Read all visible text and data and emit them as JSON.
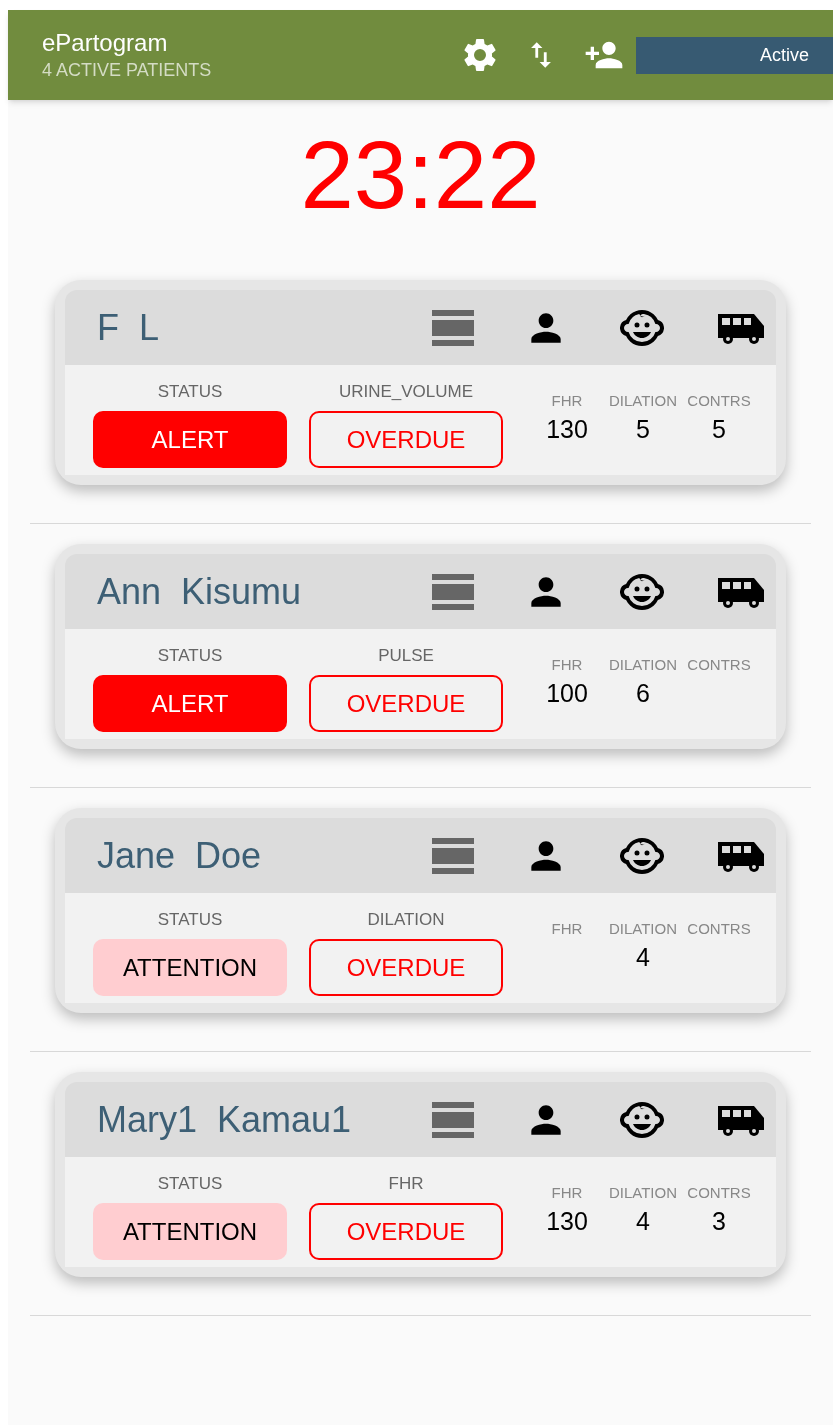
{
  "app_bar": {
    "title": "ePartogram",
    "subtitle": "4 ACTIVE PATIENTS",
    "filter": "Active"
  },
  "timer": "23:22",
  "patients": [
    {
      "name": "F  L",
      "status_label": "STATUS",
      "status": {
        "text": "ALERT",
        "kind": "alert"
      },
      "due_label": "URINE_VOLUME",
      "due": "OVERDUE",
      "metrics": [
        {
          "label": "FHR",
          "value": "130"
        },
        {
          "label": "DILATION",
          "value": "5"
        },
        {
          "label": "CONTRS",
          "value": "5"
        }
      ]
    },
    {
      "name": "Ann  Kisumu",
      "status_label": "STATUS",
      "status": {
        "text": "ALERT",
        "kind": "alert"
      },
      "due_label": "PULSE",
      "due": "OVERDUE",
      "metrics": [
        {
          "label": "FHR",
          "value": "100"
        },
        {
          "label": "DILATION",
          "value": "6"
        },
        {
          "label": "CONTRS"
        }
      ]
    },
    {
      "name": "Jane  Doe",
      "status_label": "STATUS",
      "status": {
        "text": "ATTENTION",
        "kind": "attention"
      },
      "due_label": "DILATION",
      "due": "OVERDUE",
      "metrics": [
        {
          "label": "FHR"
        },
        {
          "label": "DILATION",
          "value": "4"
        },
        {
          "label": "CONTRS"
        }
      ]
    },
    {
      "name": "Mary1  Kamau1",
      "status_label": "STATUS",
      "status": {
        "text": "ATTENTION",
        "kind": "attention"
      },
      "due_label": "FHR",
      "due": "OVERDUE",
      "metrics": [
        {
          "label": "FHR",
          "value": "130"
        },
        {
          "label": "DILATION",
          "value": "4"
        },
        {
          "label": "CONTRS",
          "value": "3"
        }
      ]
    }
  ]
}
